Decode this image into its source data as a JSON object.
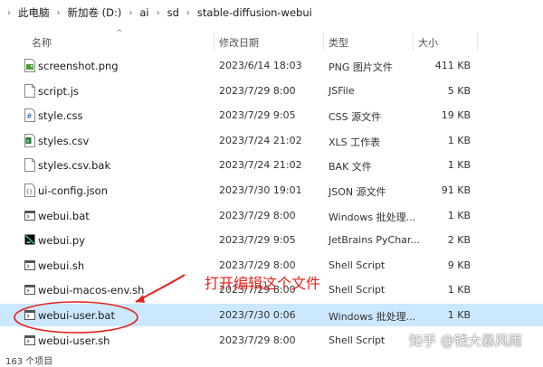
{
  "breadcrumb": [
    "此电脑",
    "新加卷 (D:)",
    "ai",
    "sd",
    "stable-diffusion-webui"
  ],
  "columns": {
    "name": "名称",
    "date": "修改日期",
    "type": "类型",
    "size": "大小"
  },
  "files": [
    {
      "name": "screenshot.png",
      "date": "2023/6/14 18:03",
      "type": "PNG 图片文件",
      "size": "411 KB",
      "icon": "image-file-icon"
    },
    {
      "name": "script.js",
      "date": "2023/7/29 8:00",
      "type": "JSFile",
      "size": "5 KB",
      "icon": "script-file-icon"
    },
    {
      "name": "style.css",
      "date": "2023/7/29 9:05",
      "type": "CSS 源文件",
      "size": "19 KB",
      "icon": "css-file-icon"
    },
    {
      "name": "styles.csv",
      "date": "2023/7/24 21:02",
      "type": "XLS 工作表",
      "size": "1 KB",
      "icon": "spreadsheet-file-icon"
    },
    {
      "name": "styles.csv.bak",
      "date": "2023/7/24 21:02",
      "type": "BAK 文件",
      "size": "1 KB",
      "icon": "generic-file-icon"
    },
    {
      "name": "ui-config.json",
      "date": "2023/7/30 19:01",
      "type": "JSON 源文件",
      "size": "91 KB",
      "icon": "json-file-icon"
    },
    {
      "name": "webui.bat",
      "date": "2023/7/29 8:00",
      "type": "Windows 批处理...",
      "size": "1 KB",
      "icon": "batch-file-icon"
    },
    {
      "name": "webui.py",
      "date": "2023/7/29 9:05",
      "type": "JetBrains PyChar...",
      "size": "2 KB",
      "icon": "python-file-icon"
    },
    {
      "name": "webui.sh",
      "date": "2023/7/29 8:00",
      "type": "Shell Script",
      "size": "9 KB",
      "icon": "shell-file-icon"
    },
    {
      "name": "webui-macos-env.sh",
      "date": "2023/7/29 8:00",
      "type": "Shell Script",
      "size": "1 KB",
      "icon": "shell-file-icon"
    },
    {
      "name": "webui-user.bat",
      "date": "2023/7/30 0:06",
      "type": "Windows 批处理...",
      "size": "1 KB",
      "icon": "batch-file-icon",
      "selected": true
    },
    {
      "name": "webui-user.sh",
      "date": "2023/7/29 8:00",
      "type": "Shell Script",
      "size": "",
      "icon": "shell-file-icon"
    }
  ],
  "status": "163 个项目",
  "annotation": "打开编辑这个文件",
  "watermark": "知乎 @钱大暴风雨",
  "colors": {
    "selected_bg": "#cce8ff",
    "annotation": "#e8201a"
  }
}
